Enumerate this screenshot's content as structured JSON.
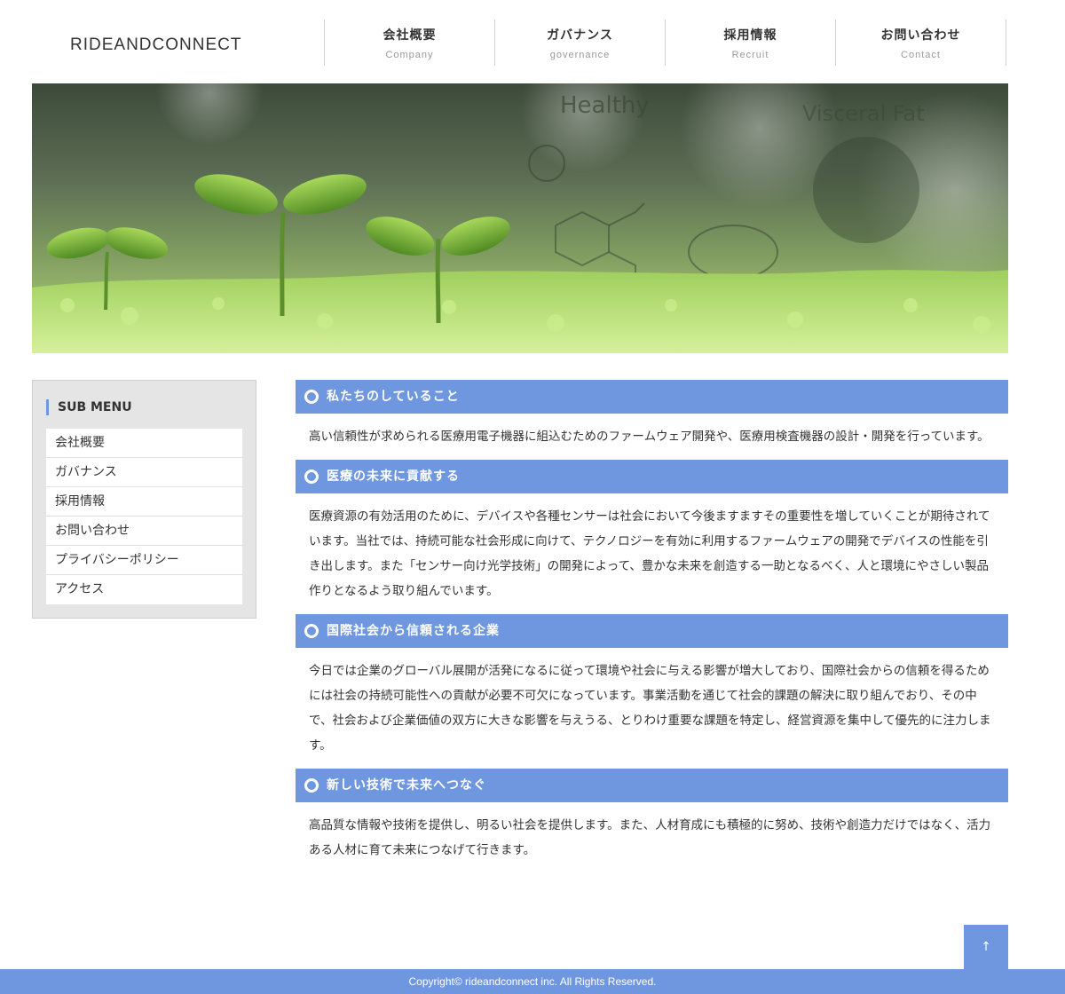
{
  "header": {
    "logo": "RIDEANDCONNECT",
    "nav": [
      {
        "label": "会社概要",
        "sub": "Company"
      },
      {
        "label": "ガバナンス",
        "sub": "governance"
      },
      {
        "label": "採用情報",
        "sub": "Recruit"
      },
      {
        "label": "お問い合わせ",
        "sub": "Contact"
      }
    ]
  },
  "hero": {
    "overlay_words": [
      "Healthy",
      "Visceral Fat"
    ]
  },
  "sidebar": {
    "title": "SUB MENU",
    "items": [
      "会社概要",
      "ガバナンス",
      "採用情報",
      "お問い合わせ",
      "プライバシーポリシー",
      "アクセス"
    ]
  },
  "sections": [
    {
      "heading": "私たちのしていること",
      "body": "高い信頼性が求められる医療用電子機器に組込むためのファームウェア開発や、医療用検査機器の設計・開発を行っています。"
    },
    {
      "heading": "医療の未来に貢献する",
      "body": "医療資源の有効活用のために、デバイスや各種センサーは社会において今後ますますその重要性を増していくことが期待されています。当社では、持続可能な社会形成に向けて、テクノロジーを有効に利用するファームウェアの開発でデバイスの性能を引き出します。また「センサー向け光学技術」の開発によって、豊かな未来を創造する一助となるべく、人と環境にやさしい製品作りとなるよう取り組んでいます。"
    },
    {
      "heading": "国際社会から信頼される企業",
      "body": "今日では企業のグローバル展開が活発になるに従って環境や社会に与える影響が増大しており、国際社会からの信頼を得るためには社会の持続可能性への貢献が必要不可欠になっています。事業活動を通じて社会的課題の解決に取り組んでおり、その中で、社会および企業価値の双方に大きな影響を与えうる、とりわけ重要な課題を特定し、経営資源を集中して優先的に注力します。"
    },
    {
      "heading": "新しい技術で未来へつなぐ",
      "body": "高品質な情報や技術を提供し、明るい社会を提供します。また、人材育成にも積極的に努め、技術や創造力だけではなく、活力ある人材に育て未来につなげて行きます。"
    }
  ],
  "totop": "↑",
  "footer": {
    "copyright": "Copyright© rideandconnect inc. All Rights Reserved."
  },
  "colors": {
    "accent": "#6f97e0",
    "sidebar_bg": "#e5e5e5"
  }
}
